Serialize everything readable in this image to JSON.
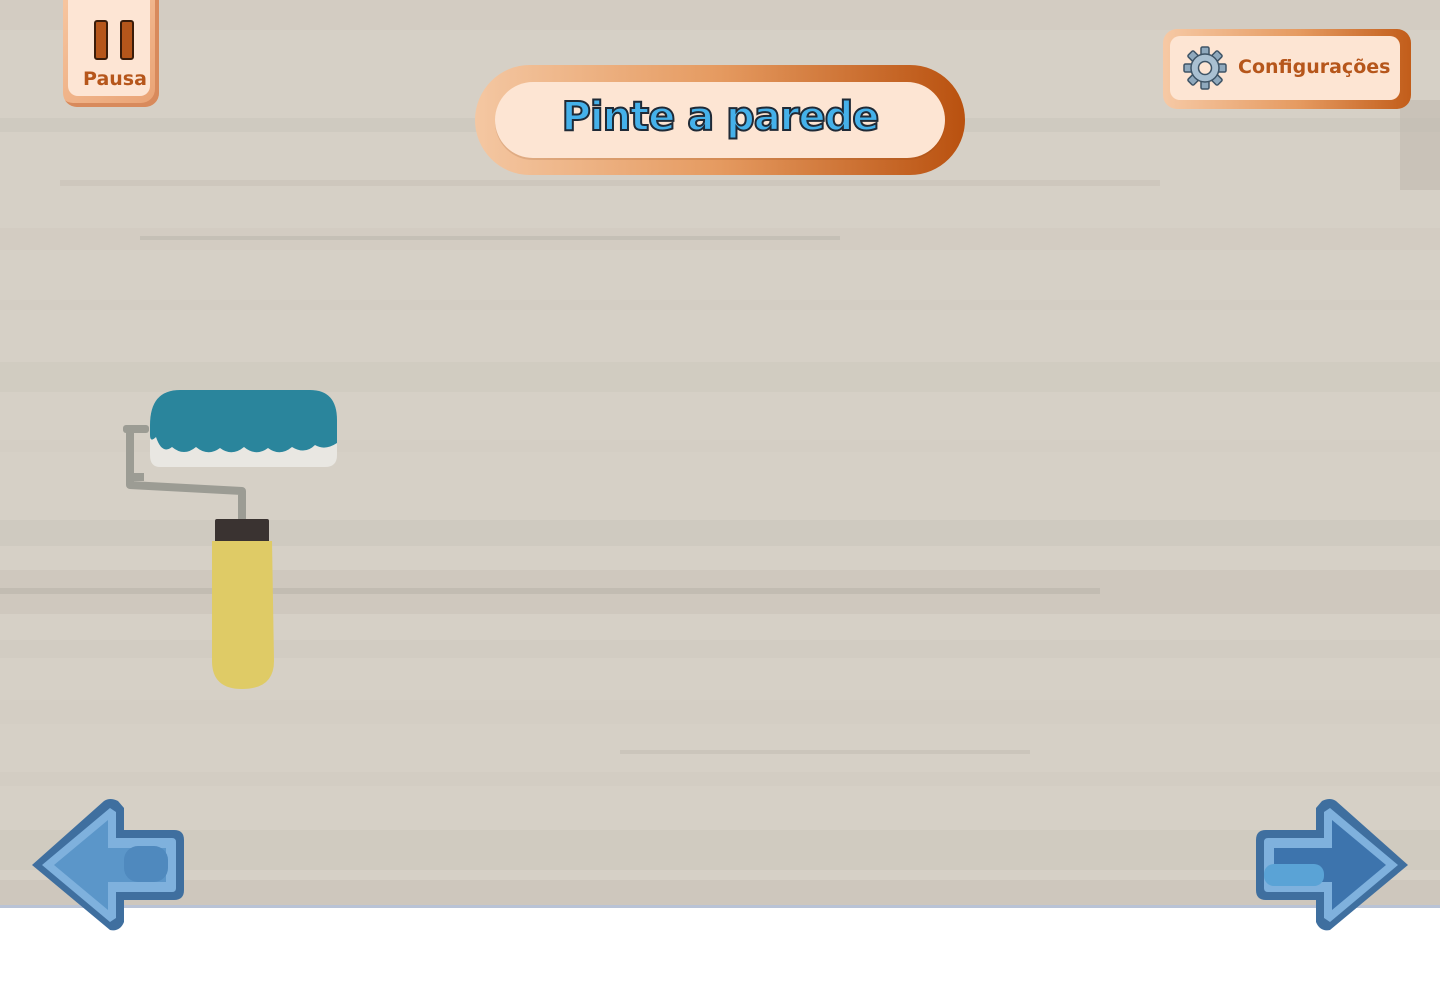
{
  "hud": {
    "pause_label": "Pausa",
    "settings_label": "Configurações"
  },
  "activity": {
    "title": "Pinte a parede"
  },
  "scene": {
    "tool": "paint-roller",
    "roller_color": "#2a859c",
    "handle_color": "#dfcb66",
    "wall_color": "#d7d1c7"
  },
  "navigation": {
    "previous_icon": "left-arrow-icon",
    "next_icon": "right-arrow-icon"
  },
  "colors": {
    "accent_orange": "#b6561b",
    "title_blue": "#45b1ea",
    "arrow_blue": "#3d6fa3"
  }
}
